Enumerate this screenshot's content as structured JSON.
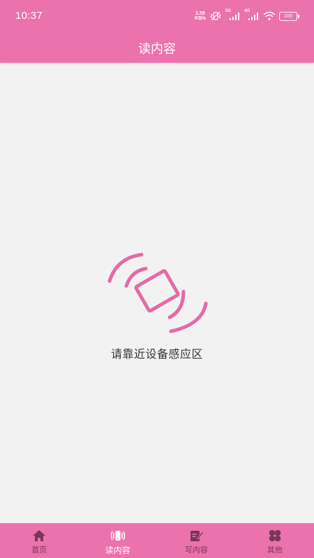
{
  "status_bar": {
    "time": "10:37",
    "net_speed_value": "1.59",
    "net_speed_unit": "KB/s",
    "signal_1_label": "5G",
    "signal_2_label": "4G",
    "battery": "100"
  },
  "header": {
    "title": "读内容"
  },
  "main": {
    "hint": "请靠近设备感应区",
    "icon": "nfc-phone-icon"
  },
  "bottom_nav": {
    "items": [
      {
        "label": "首页",
        "icon": "home-icon",
        "active": false
      },
      {
        "label": "读内容",
        "icon": "nfc-read-icon",
        "active": true
      },
      {
        "label": "写内容",
        "icon": "edit-icon",
        "active": false
      },
      {
        "label": "其他",
        "icon": "grid-icon",
        "active": false
      }
    ]
  },
  "colors": {
    "primary": "#ec72ad",
    "background": "#f2f2f2",
    "inactive_nav": "#7a3658"
  }
}
